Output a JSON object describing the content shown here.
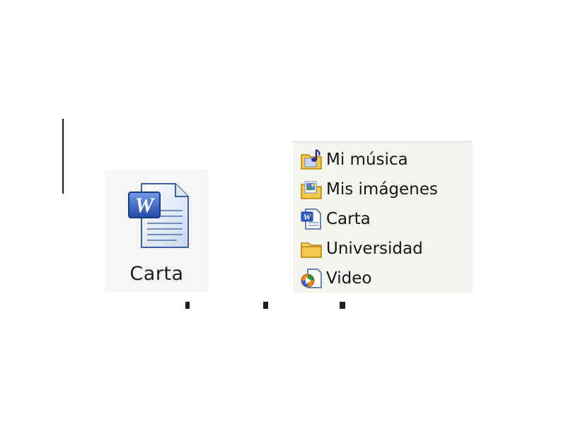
{
  "desktop_icon": {
    "label": "Carta",
    "icon": "word-document-icon"
  },
  "file_list": {
    "items": [
      {
        "label": "Mi música",
        "icon": "music-folder-icon"
      },
      {
        "label": "Mis imágenes",
        "icon": "pictures-folder-icon"
      },
      {
        "label": "Carta",
        "icon": "word-document-icon"
      },
      {
        "label": "Universidad",
        "icon": "folder-icon"
      },
      {
        "label": "Video",
        "icon": "media-video-icon"
      }
    ]
  },
  "colors": {
    "folder": "#f2c94c",
    "word_blue": "#2a56b8",
    "panel_bg": "#f5f4f1"
  }
}
